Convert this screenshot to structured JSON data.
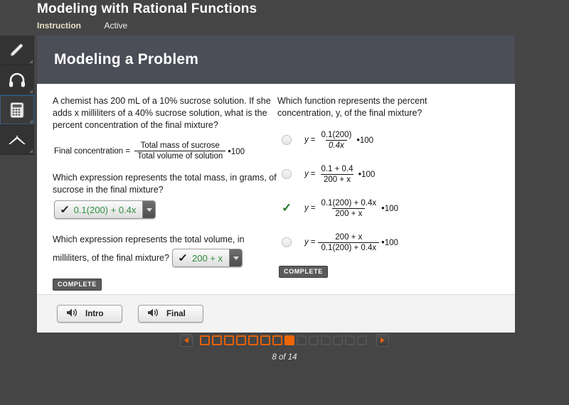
{
  "header": {
    "course_title": "Modeling with Rational Functions",
    "tabs": [
      {
        "label": "Instruction",
        "state": "selected"
      },
      {
        "label": "Active",
        "state": "normal"
      }
    ]
  },
  "toolrail": {
    "items": [
      {
        "icon": "pencil-icon",
        "selected": false
      },
      {
        "icon": "headphones-icon",
        "selected": false
      },
      {
        "icon": "calculator-icon",
        "selected": true
      },
      {
        "icon": "chevron-up-icon",
        "selected": false
      }
    ]
  },
  "card": {
    "title": "Modeling a Problem",
    "left": {
      "prompt": "A chemist has 200 mL of a 10% sucrose solution. If she adds x milliliters of a 40% sucrose solution, what is the percent concentration of the final mixture?",
      "formula": {
        "lhs": "Final concentration =",
        "numerator": "Total mass of sucrose",
        "denominator": "Total volume of solution",
        "multiplier": "100",
        "dot": "•"
      },
      "question1": "Which expression represents the total mass, in grams, of sucrose in the final mixture?",
      "answer1": {
        "value": "0.1(200) + 0.4x",
        "check": "✓"
      },
      "question2": "Which expression represents the total volume, in milliliters, of the final mixture?",
      "answer2": {
        "value": "200 + x",
        "check": "✓"
      },
      "complete_badge": "COMPLETE"
    },
    "right": {
      "prompt_a": "Which function represents the percent",
      "prompt_b": "concentration, y, of the final mixture?",
      "choices": [
        {
          "lhs": "y",
          "eqsign": "=",
          "numerator": "0.1(200)",
          "denominator": "0.4x",
          "dot": "•",
          "multiplier": "100",
          "selected": false,
          "correct": false
        },
        {
          "lhs": "y",
          "eqsign": "=",
          "numerator": "0.1 + 0.4",
          "denominator": "200 + x",
          "dot": "•",
          "multiplier": "100",
          "selected": false,
          "correct": false
        },
        {
          "lhs": "y",
          "eqsign": "=",
          "numerator": "0.1(200) + 0.4x",
          "denominator": "200 + x",
          "dot": "•",
          "multiplier": "100",
          "selected": true,
          "correct": true
        },
        {
          "lhs": "y",
          "eqsign": "=",
          "numerator": "200 + x",
          "denominator": "0.1(200) + 0.4x",
          "dot": "•",
          "multiplier": "100",
          "selected": false,
          "correct": false
        }
      ],
      "complete_badge": "COMPLETE"
    },
    "footer": {
      "buttons": [
        {
          "label": "Intro",
          "icon": "speaker-icon"
        },
        {
          "label": "Final",
          "icon": "speaker-icon"
        }
      ]
    }
  },
  "pager": {
    "prev_icon": "triangle-left-icon",
    "next_icon": "triangle-right-icon",
    "total_pages": 14,
    "current_page": 8,
    "page_label": "8 of 14",
    "accent_color": "#ec6608"
  }
}
